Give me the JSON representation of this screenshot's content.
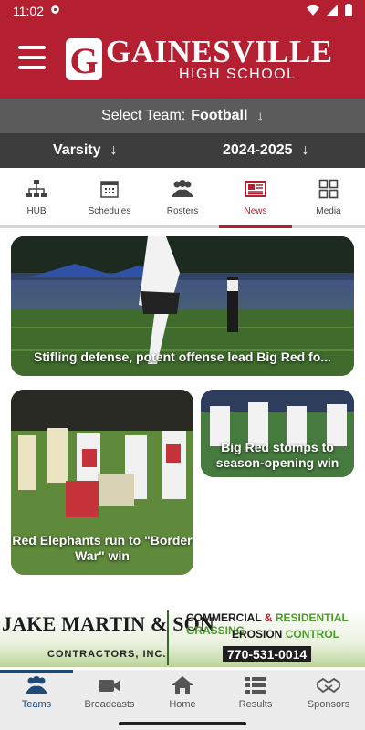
{
  "status_bar": {
    "time": "11:02"
  },
  "header": {
    "school_name": "GAINESVILLE",
    "school_sub": "HIGH SCHOOL",
    "logo_letter": "G"
  },
  "team_selector": {
    "label": "Select Team:",
    "value": "Football"
  },
  "level_selector": {
    "level": "Varsity",
    "season": "2024-2025"
  },
  "tabs": [
    {
      "label": "HUB",
      "icon": "hub-icon"
    },
    {
      "label": "Schedules",
      "icon": "calendar-icon"
    },
    {
      "label": "Rosters",
      "icon": "people-icon"
    },
    {
      "label": "News",
      "icon": "newspaper-icon",
      "active": true
    },
    {
      "label": "Media",
      "icon": "grid-icon"
    }
  ],
  "news": [
    {
      "title": "Stifling defense, potent offense lead Big Red fo..."
    },
    {
      "title": "Red Elephants run to \"Border War\" win"
    },
    {
      "title": "Big Red stomps to season-opening win"
    }
  ],
  "sponsor": {
    "name": "JAKE MARTIN & SON",
    "sub": "CONTRACTORS, INC.",
    "line1_a": "COMMERCIAL",
    "line1_b": "&",
    "line1_c": "RESIDENTIAL",
    "line1_d": "GRASSING",
    "line2_a": "EROSION",
    "line2_b": "CONTROL",
    "phone": "770-531-0014"
  },
  "bottom_nav": [
    {
      "label": "Teams",
      "icon": "teams-icon",
      "active": true
    },
    {
      "label": "Broadcasts",
      "icon": "video-camera-icon"
    },
    {
      "label": "Home",
      "icon": "home-icon"
    },
    {
      "label": "Results",
      "icon": "results-list-icon"
    },
    {
      "label": "Sponsors",
      "icon": "handshake-icon"
    }
  ],
  "colors": {
    "brand": "#b41f32",
    "team_bar": "#5b5b5b",
    "level_bar": "#3d3d3d",
    "nav_active": "#1e4a7a"
  }
}
